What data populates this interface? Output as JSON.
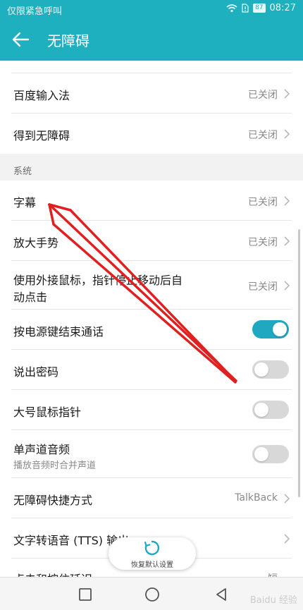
{
  "status_bar": {
    "carrier": "仅限紧急呼叫",
    "battery": "87",
    "time": "08:27"
  },
  "header": {
    "title": "无障碍"
  },
  "items": {
    "baidu_ime": {
      "label": "百度输入法",
      "value": "已关闭"
    },
    "dedao": {
      "label": "得到无障碍",
      "value": "已关闭"
    },
    "section_system": "系统",
    "captions": {
      "label": "字幕",
      "value": "已关闭"
    },
    "magnify": {
      "label": "放大手势",
      "value": "已关闭"
    },
    "mouse_click": {
      "label_line1": "使用外接鼠标，指针停止移动后自",
      "label_line2": "动点击",
      "value": "已关闭"
    },
    "power_end_call": {
      "label": "按电源键结束通话",
      "on": true
    },
    "speak_passwords": {
      "label": "说出密码",
      "on": false
    },
    "large_pointer": {
      "label": "大号鼠标指针",
      "on": false
    },
    "mono_audio": {
      "label": "单声道音频",
      "sub": "播放音频时合并声道",
      "on": false
    },
    "shortcut": {
      "label": "无障碍快捷方式",
      "value": "TalkBack"
    },
    "tts": {
      "label": "文字转语音 (TTS) 输出"
    },
    "touch_delay": {
      "label": "点击和按住延迟",
      "value": "短"
    }
  },
  "restore_button": {
    "label": "恢复默认设置"
  },
  "colors": {
    "accent": "#1fb0bf",
    "toggle_on": "#1fa8c0",
    "annotation_arrow": "#e02020"
  },
  "watermark": "Baidu 经验"
}
